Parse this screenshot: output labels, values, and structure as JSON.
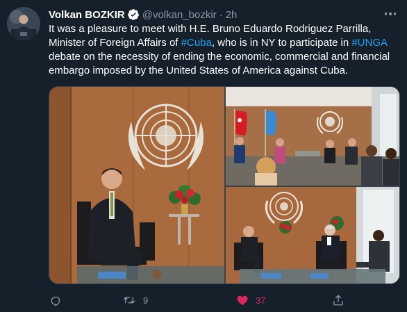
{
  "tweet": {
    "author_name": "Volkan BOZKIR",
    "handle": "@volkan_bozkir",
    "separator": "·",
    "time": "2h",
    "text_parts": [
      {
        "text": "It was a pleasure to meet with H.E. Bruno Eduardo Rodriguez Parrilla, Minister of Foreign Affairs of ",
        "hashtag": false
      },
      {
        "text": "#Cuba",
        "hashtag": true
      },
      {
        "text": ", who is in NY to participate in ",
        "hashtag": false
      },
      {
        "text": "#UNGA",
        "hashtag": true
      },
      {
        "text": " debate on the necessity of ending the economic, commercial and financial embargo imposed by the United States of America against Cuba.",
        "hashtag": false
      }
    ]
  },
  "actions": {
    "reply_icon": "comment-icon",
    "retweet_icon": "retweet-icon",
    "retweet_count": "9",
    "like_icon": "heart-filled-icon",
    "like_count": "37",
    "share_icon": "share-icon"
  },
  "colors": {
    "background": "#15202b",
    "text": "#ffffff",
    "secondary": "#8899a6",
    "link": "#1da1f2",
    "like": "#e0245e",
    "verified": "#1da1f2"
  }
}
